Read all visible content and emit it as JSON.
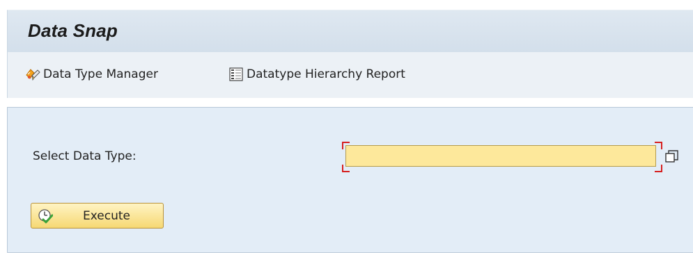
{
  "window": {
    "title": "Data Snap"
  },
  "toolbar": {
    "items": [
      {
        "label": "Data Type Manager",
        "icon": "data-type-manager-icon"
      },
      {
        "label": "Datatype Hierarchy Report",
        "icon": "report-icon"
      }
    ]
  },
  "form": {
    "field_label": "Select Data Type:",
    "field_value": "",
    "required": true,
    "f4_icon": "value-help-icon"
  },
  "actions": {
    "execute_label": "Execute",
    "execute_icon": "execute-clock-check-icon"
  },
  "colors": {
    "title_bar": "#d9e4ef",
    "panel": "#e3edf7",
    "input_bg": "#fde89b",
    "required_marker": "#d61e1e",
    "button_bg": "#f6d873"
  }
}
